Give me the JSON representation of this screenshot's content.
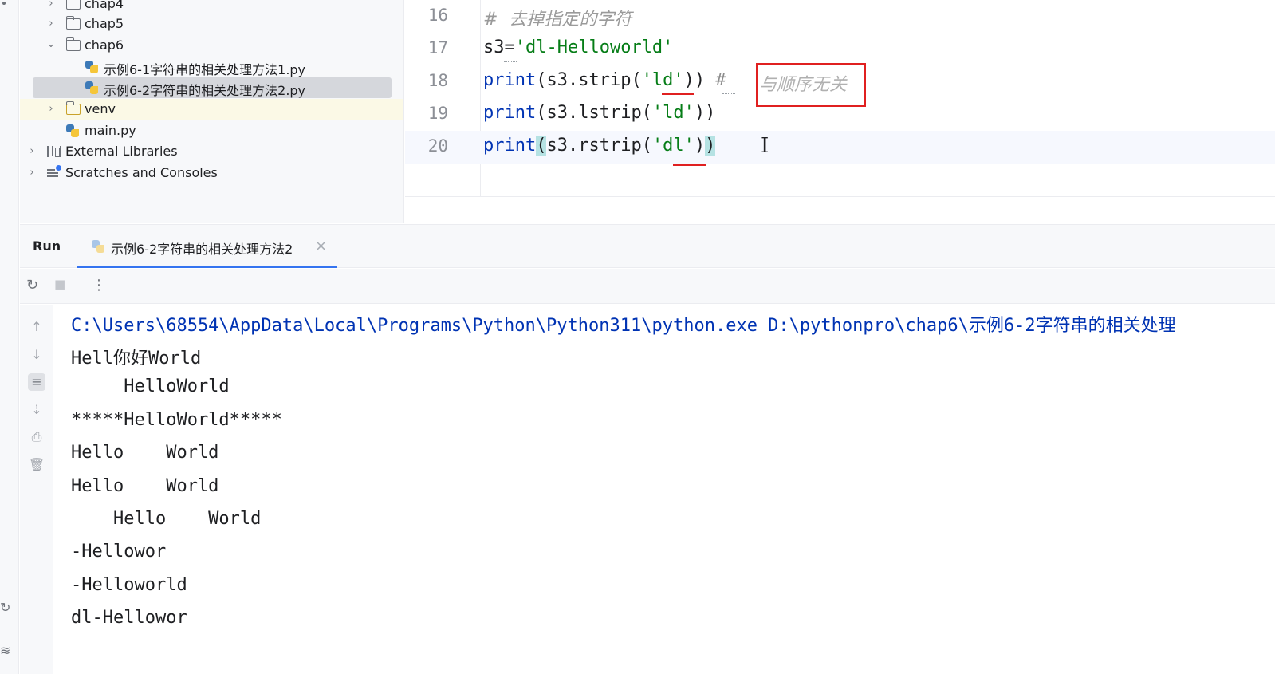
{
  "project_tree": {
    "items": [
      {
        "label": "chap4",
        "kind": "folder",
        "expanded": false
      },
      {
        "label": "chap5",
        "kind": "folder",
        "expanded": false
      },
      {
        "label": "chap6",
        "kind": "folder",
        "expanded": true
      },
      {
        "label": "示例6-1字符串的相关处理方法1.py",
        "kind": "python-file"
      },
      {
        "label": "示例6-2字符串的相关处理方法2.py",
        "kind": "python-file",
        "selected": true
      },
      {
        "label": "venv",
        "kind": "folder",
        "expanded": false
      },
      {
        "label": "main.py",
        "kind": "python-file"
      },
      {
        "label": "External Libraries",
        "kind": "library"
      },
      {
        "label": "Scratches and Consoles",
        "kind": "scratches"
      }
    ]
  },
  "editor": {
    "lines": [
      {
        "number": "16",
        "comment": "#  去掉指定的字符"
      },
      {
        "number": "17",
        "var": "s3=",
        "string": "'dl-Helloworld'"
      },
      {
        "number": "18",
        "fn": "print",
        "mid": "(s3.strip(",
        "string": "'ld'",
        "end": "))",
        "comment": " # "
      },
      {
        "number": "19",
        "fn": "print",
        "mid": "(s3.lstrip(",
        "string": "'ld'",
        "end": "))"
      },
      {
        "number": "20",
        "fn": "print",
        "paren_open": "(",
        "mid": "s3.rstrip(",
        "string": "'dl'",
        "end_a": ")",
        "paren_close": ")"
      }
    ],
    "annotation_text": "与顺序无关",
    "annotation_color": "#e02020",
    "caret_glyph": "I"
  },
  "run_panel": {
    "title": "Run",
    "tab_label": "示例6-2字符串的相关处理方法2",
    "close_glyph": "×",
    "toolbar": {
      "rerun_icon": "↻",
      "stop_icon": "■",
      "more_icon": "⋮"
    },
    "sidebar_icons": {
      "up": "↑",
      "down": "↓",
      "soft_wrap": "≡",
      "scroll_end": "⇣",
      "print": "⎙",
      "trash": "🗑"
    },
    "output": [
      "C:\\Users\\68554\\AppData\\Local\\Programs\\Python\\Python311\\python.exe D:\\pythonpro\\chap6\\示例6-2字符串的相关处理",
      "Hell你好World",
      "     HelloWorld",
      "*****HelloWorld*****",
      "Hello    World",
      "Hello    World",
      "    Hello    World",
      "-Hellowor",
      "-Helloworld",
      "dl-Hellowor"
    ]
  },
  "colors": {
    "keyword_blue": "#0033b3",
    "string_green": "#067d17",
    "comment_gray": "#8c8c8c",
    "selection_gray": "#d5d7dc",
    "accent_blue": "#3574f0"
  }
}
